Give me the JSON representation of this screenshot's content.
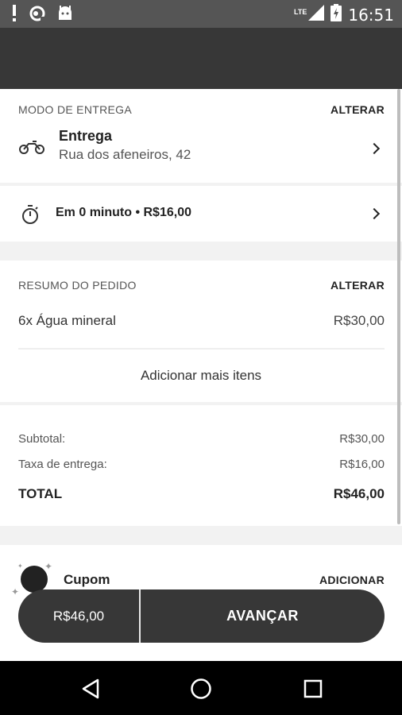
{
  "status_bar": {
    "time": "16:51",
    "network": "LTE",
    "left_icons": [
      "alert-icon",
      "sync-icon",
      "android-icon"
    ],
    "right_icons": [
      "signal-icon",
      "battery-charging-icon"
    ]
  },
  "delivery": {
    "section_label": "MODO DE ENTREGA",
    "change_label": "ALTERAR",
    "mode_title": "Entrega",
    "address": "Rua dos afeneiros, 42",
    "icon": "motorcycle-icon"
  },
  "eta": {
    "text": "Em 0 minuto • R$16,00",
    "icon": "stopwatch-icon"
  },
  "order_summary": {
    "section_label": "RESUMO DO PEDIDO",
    "change_label": "ALTERAR",
    "items": [
      {
        "description": "6x Água mineral",
        "price": "R$30,00"
      }
    ],
    "add_more_label": "Adicionar mais itens"
  },
  "totals": {
    "subtotal_label": "Subtotal:",
    "subtotal_value": "R$30,00",
    "fee_label": "Taxa de entrega:",
    "fee_value": "R$16,00",
    "total_label": "TOTAL",
    "total_value": "R$46,00"
  },
  "coupon": {
    "title": "Cupom",
    "action_label": "ADICIONAR"
  },
  "bottom_button": {
    "price": "R$46,00",
    "next_label": "AVANÇAR"
  },
  "nav_bar": {
    "buttons": [
      "back-icon",
      "home-icon",
      "recents-icon"
    ]
  },
  "colors": {
    "status_bar": "#555555",
    "app_bar": "#373737",
    "background": "#f2f2f2",
    "button": "#373737"
  }
}
